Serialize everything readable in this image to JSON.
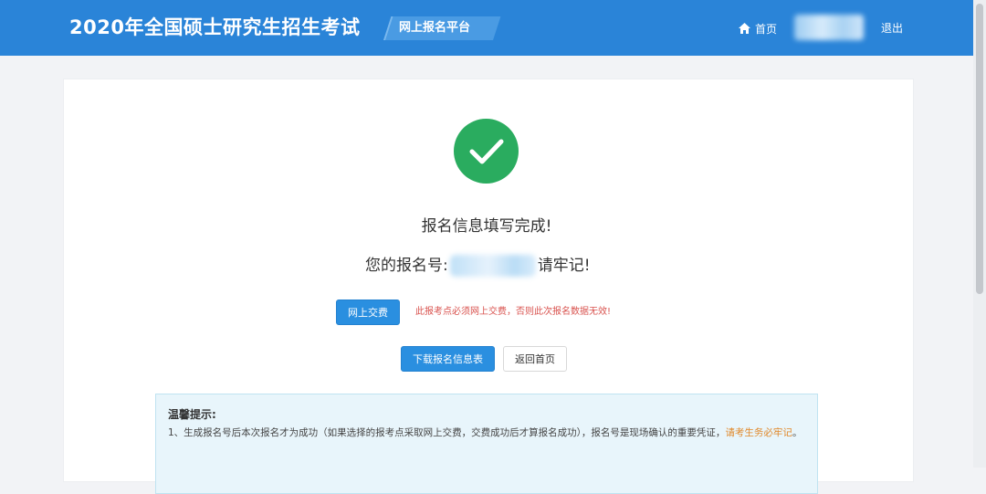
{
  "header": {
    "site_title": "2020年全国硕士研究生招生考试",
    "platform_tag": "网上报名平台",
    "nav_home": "首页",
    "nav_logout": "退出"
  },
  "main": {
    "complete_message": "报名信息填写完成!",
    "regno_prefix": "您的报名号:",
    "regno_suffix": "请牢记!",
    "pay_button": "网上交费",
    "pay_warning": "此报考点必须网上交费，否则此次报名数据无效!",
    "download_button": "下载报名信息表",
    "back_button": "返回首页"
  },
  "tips": {
    "title": "温馨提示:",
    "line1_text": "1、生成报名号后本次报名才为成功（如果选择的报考点采取网上交费，交费成功后才算报名成功），报名号是现场确认的重要凭证，",
    "line1_highlight": "请考生务必牢记",
    "line1_end": "。"
  },
  "colors": {
    "header_bg": "#2a84d8",
    "success_green": "#2aac5f",
    "primary_button": "#2a8fe0",
    "warning_red": "#d9534f",
    "highlight_orange": "#e0882a"
  }
}
